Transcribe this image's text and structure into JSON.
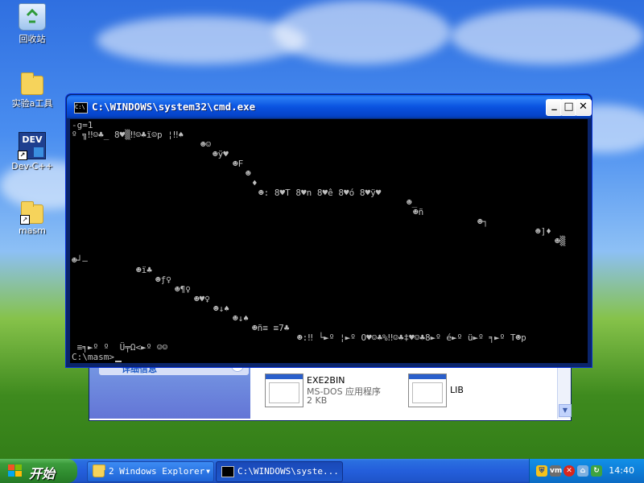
{
  "desktop": {
    "icons": [
      {
        "label": "回收站",
        "icon": "recycle-bin-icon"
      },
      {
        "label": "实验a工具",
        "icon": "folder-icon"
      },
      {
        "label": "Dev-C++",
        "icon": "dev-cpp-icon",
        "badge": "DEV"
      },
      {
        "label": "masm",
        "icon": "folder-shortcut-icon"
      }
    ]
  },
  "cmd_window": {
    "title": "C:\\WINDOWS\\system32\\cmd.exe",
    "icon_text": "C:\\",
    "buttons": {
      "minimize": "_",
      "maximize": "□",
      "close": "✕"
    },
    "lines": [
      {
        "text": "-g=1"
      },
      {
        "text": "º ╗‼☺♣_ 8♥▒‼☺♣ï☺p ¦‼♠"
      },
      {
        "text": "☻☺"
      },
      {
        "text": "☻ÿ♥"
      },
      {
        "text": "☻F"
      },
      {
        "text": "☻"
      },
      {
        "text": "♦"
      },
      {
        "text": "☻: 8♥T 8♥n 8♥ê 8♥ó 8♥ÿ♥"
      },
      {
        "text": "☻_"
      },
      {
        "text": "☻ñ"
      },
      {
        "text": "☻┐"
      },
      {
        "text": "☻]♦"
      },
      {
        "text": "☻▒"
      },
      {
        "text": "☻┘—"
      },
      {
        "text": "☻ï♣"
      },
      {
        "text": "☻ƒ♀"
      },
      {
        "text": "☻¶♀"
      },
      {
        "text": "☻♥♀"
      },
      {
        "text": "☻↓♠"
      },
      {
        "text": "☻↓♠"
      },
      {
        "text": "☻ñ≡ ≡7♣"
      },
      {
        "text": "☻:‼ └►º ¦►º O♥☺♣%‼☺♣‡♥☺♣8►º é►º ü►º ╕►º T☻p"
      },
      {
        "text": " ≡╕►º º  Ü╤Ω<►º ☺☺"
      },
      {
        "text": "C:\\masm>"
      }
    ]
  },
  "explorer_window": {
    "panel_label": "详细信息",
    "files": [
      {
        "name": "EXE2BIN",
        "type": "MS-DOS 应用程序",
        "size": "2 KB"
      },
      {
        "name": "LIB",
        "type": "",
        "size": ""
      }
    ]
  },
  "taskbar": {
    "start_label": "开始",
    "buttons": [
      {
        "label": "2 Windows Explorer",
        "active": false
      },
      {
        "label": "C:\\WINDOWS\\syste...",
        "active": true
      }
    ],
    "tray_icons": [
      "security-shield-icon",
      "vmware-icon",
      "network-error-icon",
      "network-icon",
      "update-icon"
    ],
    "clock": "14:40"
  }
}
